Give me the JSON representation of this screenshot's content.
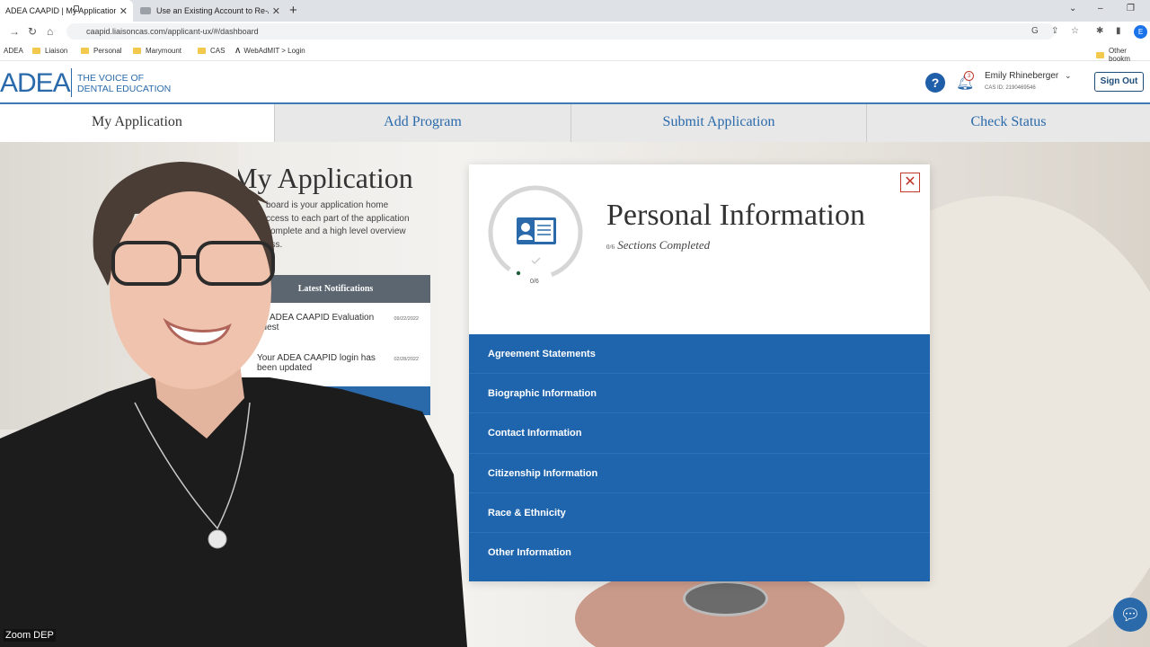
{
  "browser": {
    "tabs": [
      {
        "label": "ADEA CAAPID | My Application D",
        "active": true
      },
      {
        "label": "Use an Existing Account to Re-A",
        "active": false
      }
    ],
    "url": "caapid.liaisoncas.com/applicant-ux/#/dashboard",
    "profile_initial": "E",
    "bookmarks": [
      "ADEA",
      "Liaison",
      "Personal",
      "Marymount",
      "CAS",
      "WebAdMIT > Login"
    ],
    "other_bookmarks": "Other bookm"
  },
  "site": {
    "logo": "ADEA",
    "tagline_line1": "THE VOICE OF",
    "tagline_line2": "DENTAL EDUCATION",
    "notification_count": "3",
    "user_name": "Emily Rhineberger",
    "cas_id": "CAS ID: 2190469546",
    "sign_out": "Sign Out"
  },
  "nav": {
    "tabs": [
      "My Application",
      "Add Program",
      "Submit Application",
      "Check Status"
    ]
  },
  "dashboard": {
    "title": "My Application",
    "intro_lines": [
      "board is your application home",
      "ccess to each part of the application",
      "complete and a high level overview",
      "ess."
    ],
    "notifications_header": "Latest Notifications",
    "notifications": [
      {
        "line1": "ADEA CAAPID Evaluation",
        "line2": "quest",
        "date": "09/22/2022"
      },
      {
        "line1": "Your ADEA CAAPID login has",
        "line2": "been updated",
        "date": "02/28/2022"
      }
    ]
  },
  "modal": {
    "title": "Personal Information",
    "count": "0/6",
    "subtitle": "Sections Completed",
    "progress_label": "0/6",
    "progress_value": 0,
    "sections": [
      "Agreement Statements",
      "Biographic Information",
      "Contact Information",
      "Citizenship Information",
      "Race & Ethnicity",
      "Other Information"
    ]
  },
  "overlay": {
    "zoom_label": "Zoom DEP"
  }
}
